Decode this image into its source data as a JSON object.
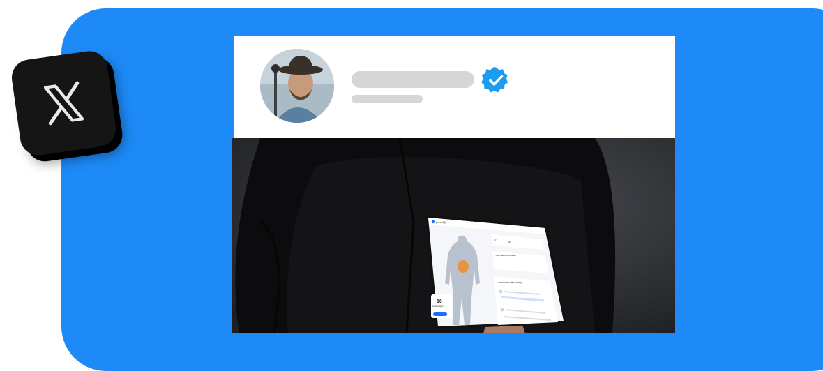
{
  "tile": {
    "icon": "x-logo-icon"
  },
  "post": {
    "avatar_icon": "avatar",
    "verified_icon": "verified-badge-icon",
    "name_placeholder": "",
    "handle_placeholder": ""
  },
  "media": {
    "alt": "Person holding a tablet showing a health app"
  },
  "tablet": {
    "brand": "genetiQ",
    "section_1": "Your Areas of Concern",
    "section_2": "Customized Care Strategy",
    "stat_value": "16",
    "stat_label": "Food Insights",
    "metric_a": "47",
    "metric_b": "54"
  },
  "colors": {
    "accent": "#1d8af7",
    "verified": "#1d9bf0"
  }
}
